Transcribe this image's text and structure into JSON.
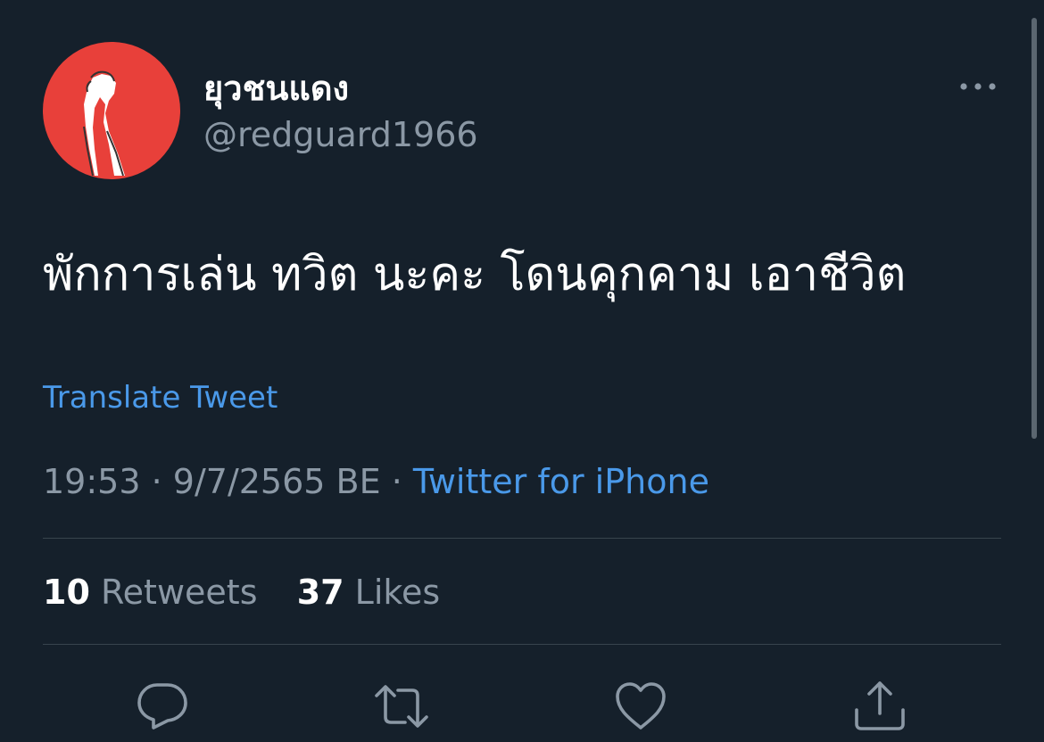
{
  "tweet": {
    "display_name": "ยุวชนแดง",
    "handle": "@redguard1966",
    "text": "พักการเล่น ทวิต นะคะ โดนคุกคาม เอาชีวิต",
    "translate_label": "Translate Tweet",
    "time": "19:53",
    "separator": "·",
    "date": "9/7/2565 BE",
    "source": "Twitter for iPhone"
  },
  "stats": {
    "retweets_count": "10",
    "retweets_label": "Retweets",
    "likes_count": "37",
    "likes_label": "Likes"
  },
  "icons": {
    "avatar": "raised-fist-arm-icon",
    "more": "more-horizontal-icon",
    "reply": "reply-icon",
    "retweet": "retweet-icon",
    "like": "heart-icon",
    "share": "share-icon"
  },
  "colors": {
    "background": "#15202b",
    "accent": "#4a99e9",
    "secondary_text": "#8b98a5",
    "avatar_bg": "#e8403a"
  }
}
